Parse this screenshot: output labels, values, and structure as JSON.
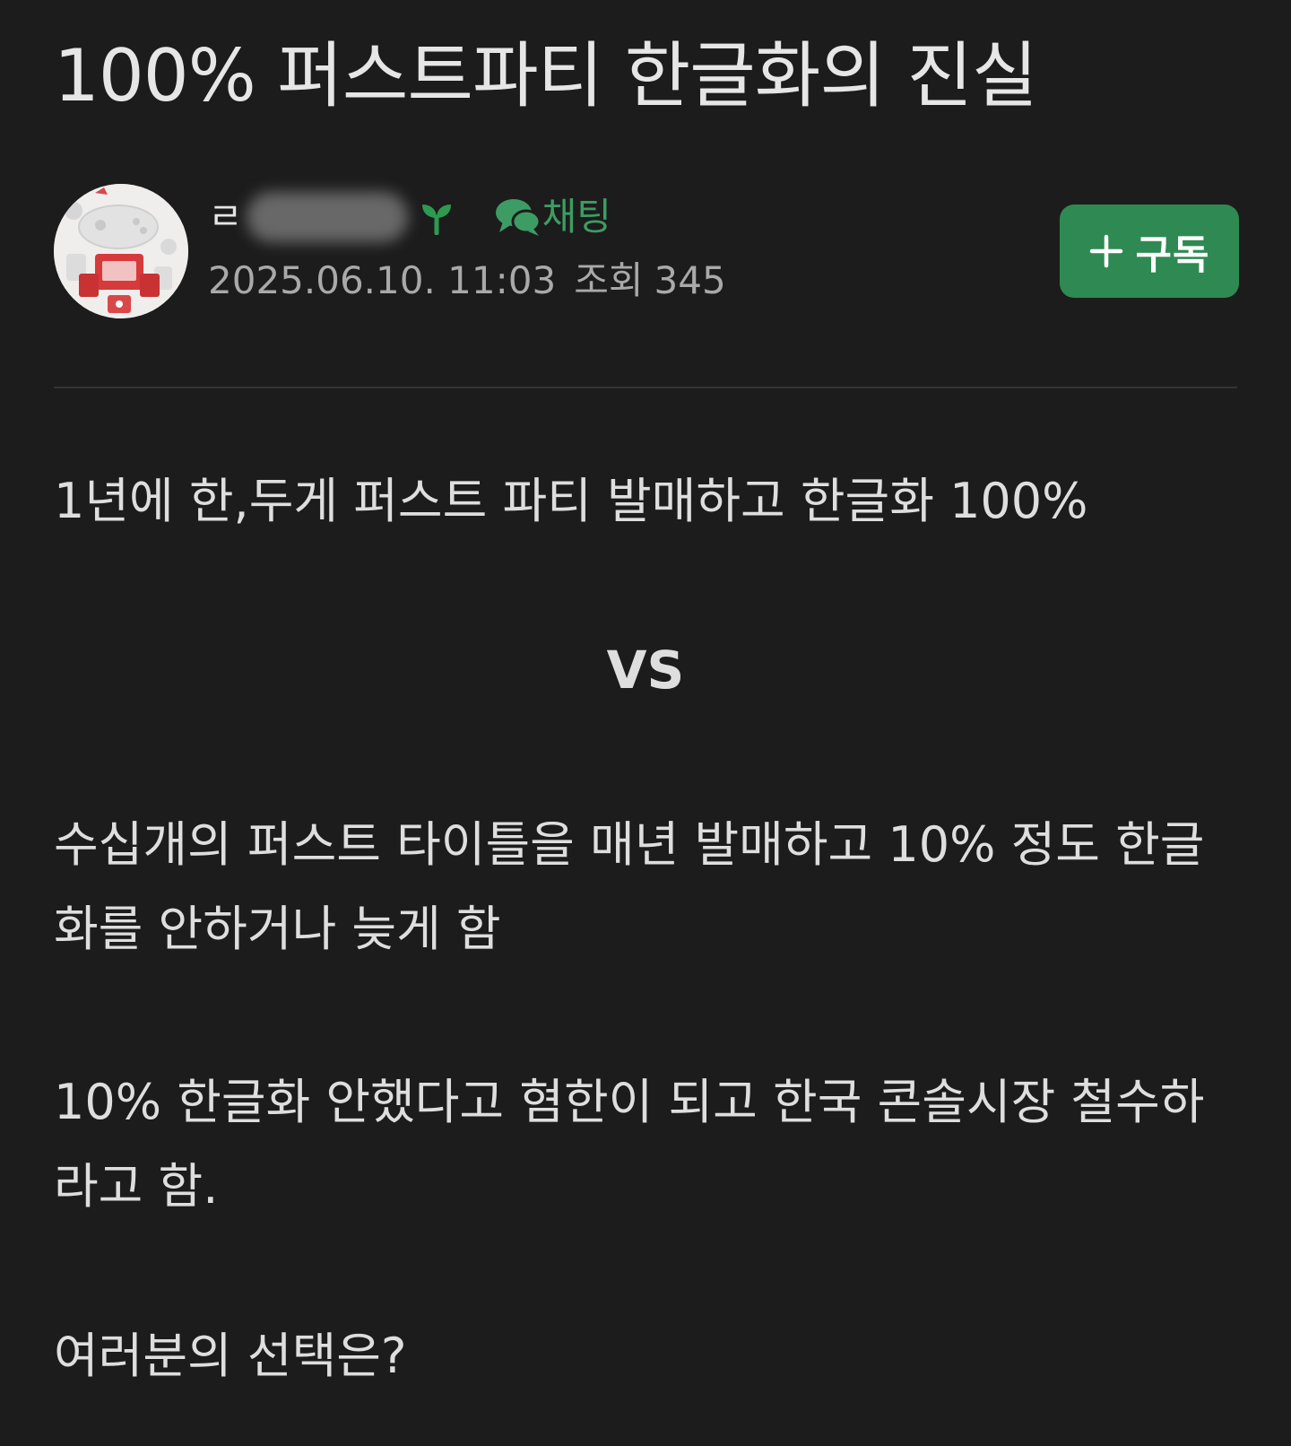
{
  "post": {
    "title": "100% 퍼스트파티 한글화의 진실"
  },
  "author": {
    "nickname_visible": "ㄹ",
    "badge_icon": "sprout-icon",
    "chat_label": "채팅",
    "chat_icon": "chat-bubbles-icon",
    "date": "2025.06.10. 11:03",
    "views_label": "조회",
    "views_count": "345"
  },
  "subscribe": {
    "label": "구독",
    "icon": "plus-icon"
  },
  "content": {
    "p1": "1년에 한,두게 퍼스트 파티 발매하고 한글화 100%",
    "vs": "VS",
    "p2": "수십개의 퍼스트 타이틀을 매년 발매하고 10% 정도 한글화를 안하거나 늦게 함",
    "p3": "10% 한글화 안했다고 혐한이 되고 한국 콘솔시장 철수하라고 함.",
    "p4": "여러분의 선택은?"
  },
  "colors": {
    "background": "#1c1c1c",
    "accent_green": "#2e8a52",
    "chat_green": "#3d9c63",
    "text": "#dedede",
    "meta_text": "#a9a9a9"
  }
}
